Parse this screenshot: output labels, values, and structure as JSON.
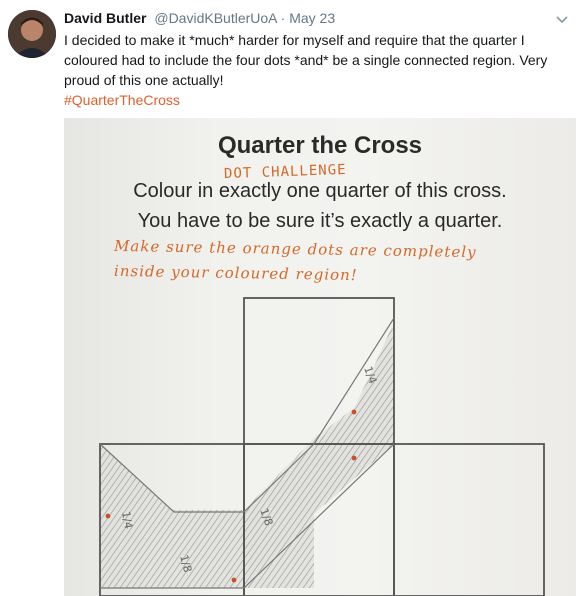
{
  "tweet": {
    "display_name": "David Butler",
    "handle": "@DavidKButlerUoA",
    "separator": "·",
    "timestamp": "May 23",
    "text_lines": [
      "I decided to make it *much* harder for myself and require that the quarter I",
      "coloured had to include the four dots *and* be a single connected region. Very",
      "proud of this one actually!"
    ],
    "hashtag": "#QuarterTheCross",
    "menu_icon": "chevron-down-icon"
  },
  "worksheet": {
    "title": "Quarter the Cross",
    "handwritten_heading": "DOT CHALLENGE",
    "instruction_1": "Colour in exactly one quarter of this cross.",
    "instruction_2": "You have to be sure it’s exactly a quarter.",
    "handwritten_note_1": "Make sure the orange dots are completely",
    "handwritten_note_2": "inside your coloured region!",
    "fraction_labels": [
      "1/4",
      "1/8",
      "1/8",
      "1/4"
    ]
  },
  "colors": {
    "hashtag": "#e0602d",
    "orange_ink": "#d4692a",
    "dot": "#c8502a"
  }
}
